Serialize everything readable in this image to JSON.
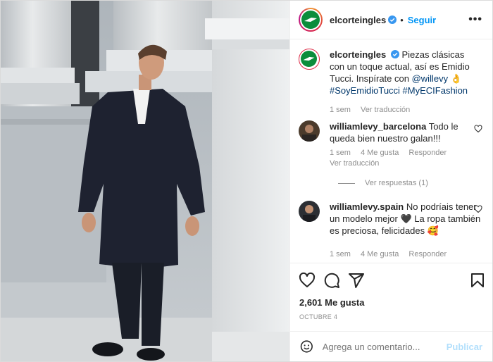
{
  "post": {
    "author": "elcorteingles",
    "follow_label": "Seguir",
    "separator": "•",
    "more_label": "•••",
    "brand_color": "#0b8d3b",
    "accent": "#0095f6"
  },
  "caption": {
    "username": "elcorteingles",
    "text_1": "Piezas clásicas con un toque actual, así es Emidio Tucci. Inspírate con",
    "mention": "@willevy",
    "emoji": "👌",
    "hashtags": "#SoyEmidioTucci #MyECIFashion",
    "time": "1 sem",
    "translate": "Ver traducción"
  },
  "comments": [
    {
      "username": "williamlevy_barcelona",
      "text": "Todo le queda bien nuestro galan!!!",
      "time": "1 sem",
      "likes": "4 Me gusta",
      "reply": "Responder",
      "translate": "Ver traducción",
      "view_replies": "Ver respuestas (1)"
    },
    {
      "username": "williamlevy.spain",
      "text_1": "No podríais tener un modelo mejor",
      "heart": "🖤",
      "text_2": "La ropa también es preciosa, felicidades",
      "emoji": "🥰",
      "time": "1 sem",
      "likes": "4 Me gusta",
      "reply": "Responder"
    }
  ],
  "actions": {
    "like_icon": "heart-icon",
    "comment_icon": "comment-icon",
    "share_icon": "share-icon",
    "save_icon": "bookmark-icon"
  },
  "stats": {
    "likes": "2,601 Me gusta",
    "date": "OCTUBRE 4"
  },
  "comment_box": {
    "placeholder": "Agrega un comentario...",
    "publish": "Publicar"
  }
}
